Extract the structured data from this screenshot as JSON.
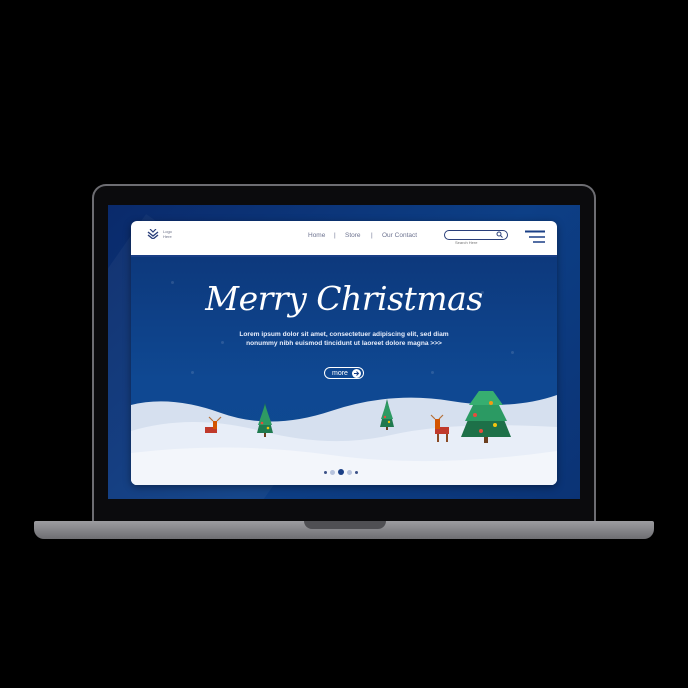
{
  "logo": {
    "text": "Logo Here"
  },
  "nav": {
    "home": "Home",
    "store": "Store",
    "contact": "Our Contact",
    "separator": "|"
  },
  "search": {
    "placeholder": "Search Here"
  },
  "hero": {
    "title": "Merry Christmas",
    "body": "Lorem ipsum dolor sit amet, consectetuer adipiscing elit, sed diam nonummy nibh euismod tincidunt ut laoreet dolore magna >>>",
    "button_label": "more"
  },
  "pagination": {
    "total": 5,
    "active": 2
  },
  "colors": {
    "navy": "#0c3476",
    "accent": "#1a3f86",
    "snow": "#e8eef8"
  }
}
